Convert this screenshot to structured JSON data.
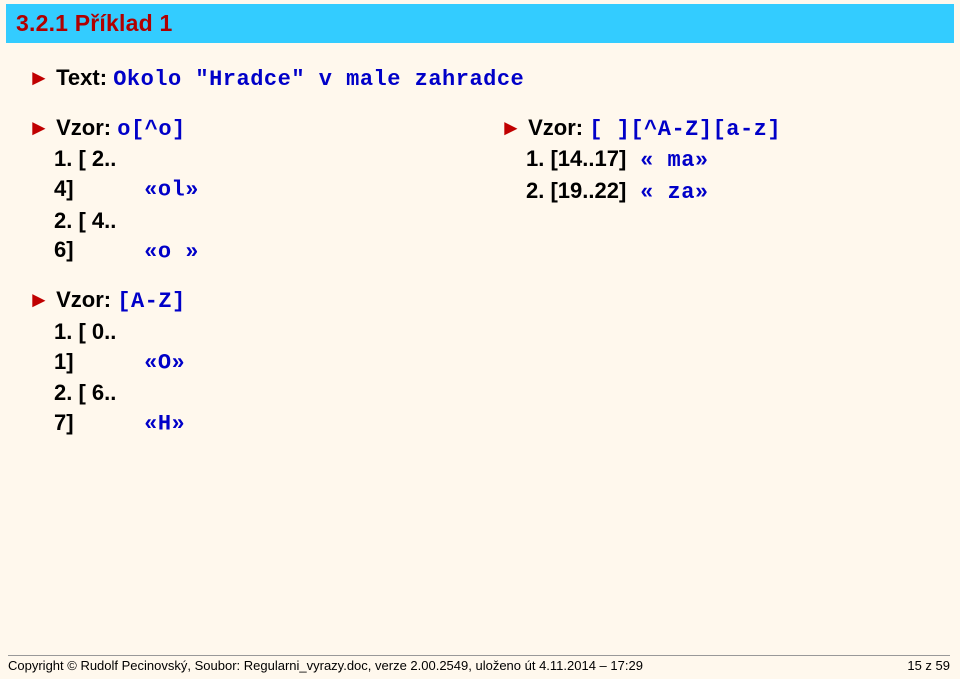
{
  "heading": "3.2.1   Příklad 1",
  "text_label": "Text:",
  "text_value": "Okolo \"Hradce\" v male zahradce",
  "left": {
    "p1": {
      "vzor_label": "Vzor:",
      "vzor_value": "o[^o]",
      "r1_idx": "1. [ 2.. 4]",
      "r1_val": "«ol»",
      "r2_idx": "2. [ 4.. 6]",
      "r2_val": "«o »"
    },
    "p2": {
      "vzor_label": "Vzor:",
      "vzor_value": "[A-Z]",
      "r1_idx": "1. [ 0.. 1]",
      "r1_val": "«O»",
      "r2_idx": "2. [ 6.. 7]",
      "r2_val": "«H»"
    }
  },
  "right": {
    "p1": {
      "vzor_label": "Vzor:",
      "vzor_value": "[ ][^A-Z][a-z]",
      "r1_idx": "1. [14..17]",
      "r1_val": "« ma»",
      "r2_idx": "2. [19..22]",
      "r2_val": "« za»"
    }
  },
  "footer_left": "Copyright © Rudolf Pecinovský, Soubor: Regularni_vyrazy.doc, verze 2.00.2549, uloženo út 4.11.2014 – 17:29",
  "footer_right": "15 z 59"
}
